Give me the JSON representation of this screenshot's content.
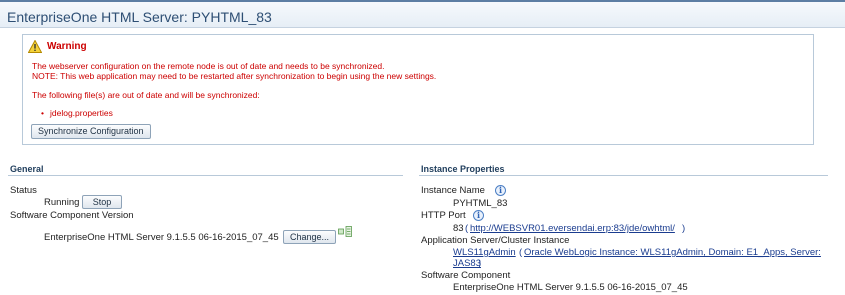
{
  "header": {
    "title": "EnterpriseOne HTML Server: PYHTML_83"
  },
  "warning": {
    "icon": "warning-triangle-icon",
    "title": "Warning",
    "line1": "The webserver configuration on the remote node is out of date and needs to be synchronized.",
    "line2": "NOTE: This web application may need to be restarted after synchronization to begin using the new settings.",
    "line3": "The following file(s) are out of date and will be synchronized:",
    "files": [
      "jdelog.properties"
    ],
    "sync_button": "Synchronize Configuration"
  },
  "general": {
    "heading": "General",
    "status_label": "Status",
    "status_value": "Running",
    "stop_button": "Stop",
    "component_version_label": "Software Component Version",
    "component_version_value": "EnterpriseOne HTML Server 9.1.5.5 06-16-2015_07_45",
    "change_button": "Change..."
  },
  "instance": {
    "heading": "Instance Properties",
    "instance_name_label": "Instance Name",
    "instance_name_value": "PYHTML_83",
    "http_port_label": "HTTP Port",
    "http_port_value": "83",
    "http_port_link": "http://WEBSVR01.eversendai.erp:83/jde/owhtml/",
    "app_server_label": "Application Server/Cluster Instance",
    "app_server_link": "WLS11gAdmin",
    "app_server_detail_line1": "Oracle WebLogic Instance: WLS11gAdmin, Domain: E1_Apps, Server:",
    "app_server_detail_line2": "JAS83",
    "software_component_label": "Software Component",
    "software_component_value": "EnterpriseOne HTML Server 9.1.5.5 06-16-2015_07_45"
  },
  "colors": {
    "warning_red": "#cc0000",
    "link_blue": "#1a3c8f",
    "header_blue": "#2e4f74"
  }
}
